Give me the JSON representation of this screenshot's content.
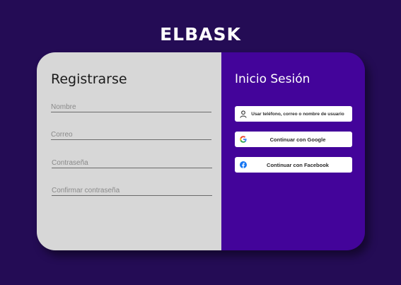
{
  "brand": {
    "name": "ELBASK"
  },
  "register": {
    "title": "Registrarse",
    "fields": {
      "name_placeholder": "Nombre",
      "email_placeholder": "Correo",
      "password_placeholder": "Contraseña",
      "confirm_placeholder": "Confirmar contraseña"
    }
  },
  "login": {
    "title": "Inicio Sesión",
    "buttons": {
      "user": {
        "label": "Usar teléfono, correo o nombre de usuario",
        "icon": "user-icon"
      },
      "google": {
        "label": "Continuar con Google",
        "icon": "google-icon"
      },
      "facebook": {
        "label": "Continuar con Facebook",
        "icon": "facebook-icon"
      }
    }
  },
  "colors": {
    "background": "#240c55",
    "left_panel": "#d7d7d7",
    "right_panel": "#43049a",
    "facebook": "#1877f2"
  }
}
